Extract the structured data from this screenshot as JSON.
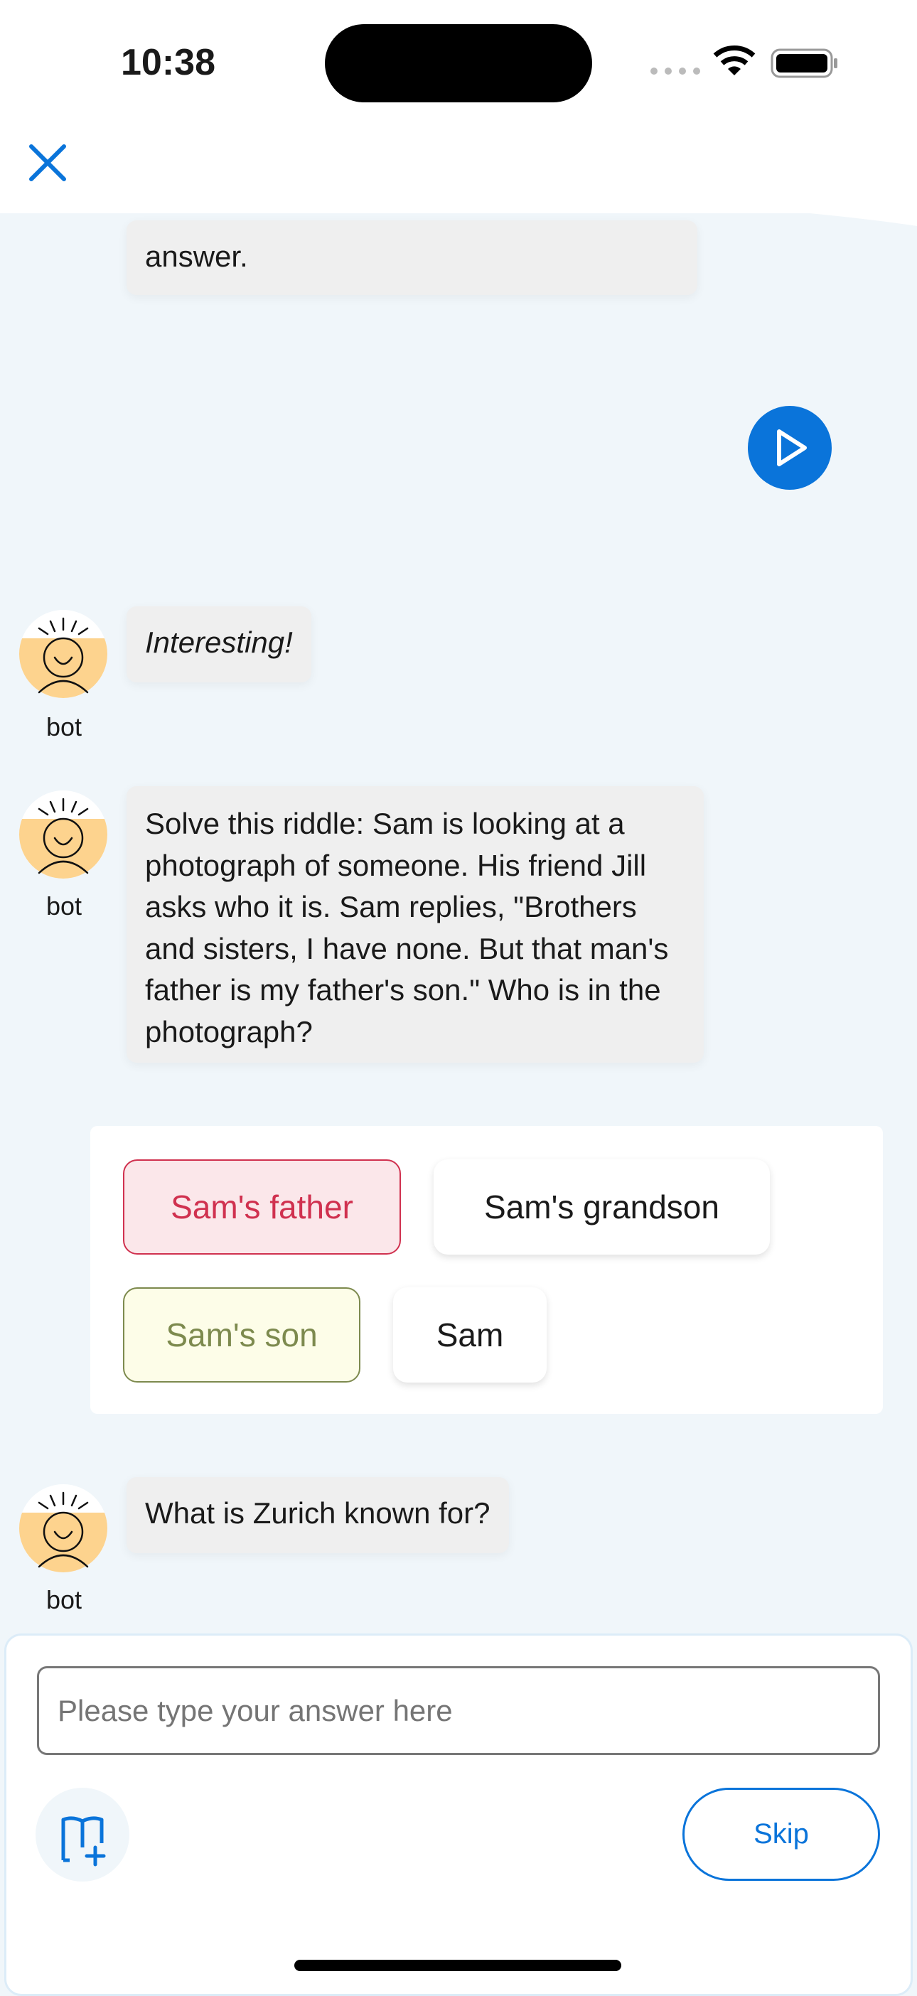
{
  "status_bar": {
    "time": "10:38"
  },
  "header": {
    "close_icon": "close-icon"
  },
  "messages": [
    {
      "text": "answer."
    },
    {
      "sender": "bot",
      "text": "Interesting!"
    },
    {
      "sender": "bot",
      "text": "Solve this riddle: Sam is looking at a photograph of someone. His friend Jill asks who it is. Sam replies, \"Brothers and sisters, I have none. But that man's father is my father's son.\" Who is in the photograph?"
    },
    {
      "sender": "bot",
      "text": "What is Zurich known for?"
    }
  ],
  "options": [
    {
      "label": "Sam's father",
      "state": "incorrect"
    },
    {
      "label": "Sam's grandson",
      "state": "default"
    },
    {
      "label": "Sam's son",
      "state": "correct"
    },
    {
      "label": "Sam",
      "state": "default"
    }
  ],
  "input": {
    "placeholder": "Please type your answer here"
  },
  "footer": {
    "skip_label": "Skip"
  },
  "colors": {
    "accent": "#0a74da",
    "background": "#f0f6fa",
    "incorrect": "#d0314f",
    "correct": "#7d8a4e"
  }
}
